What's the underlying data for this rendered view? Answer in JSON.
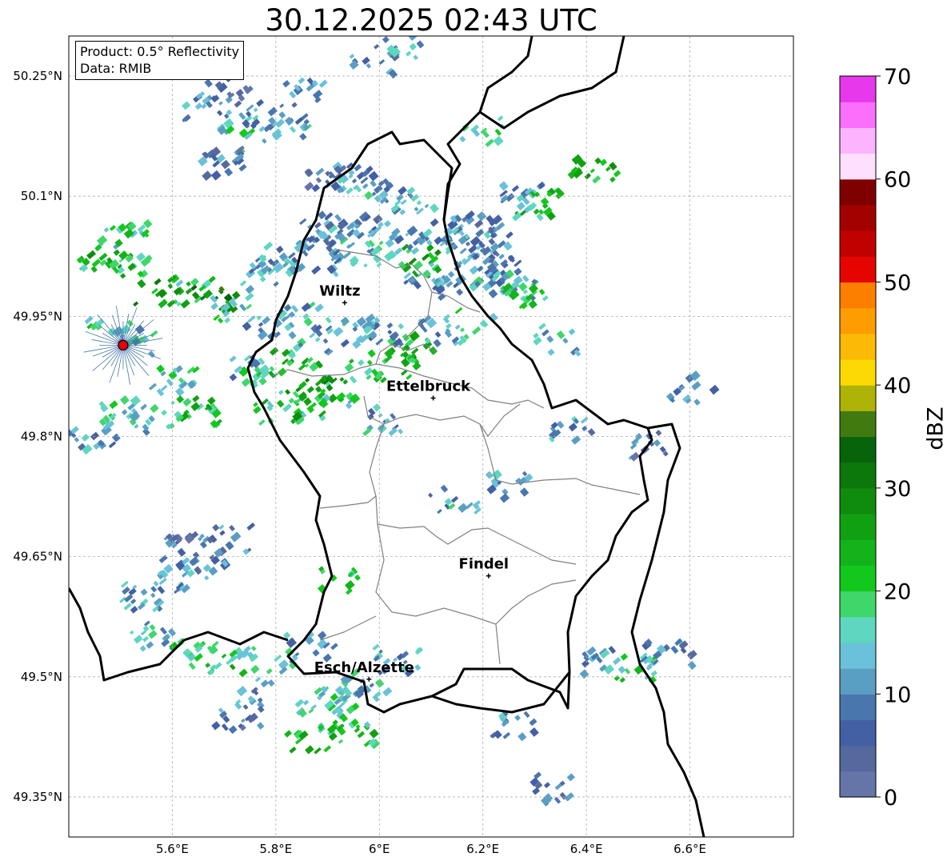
{
  "title": "30.12.2025 02:43 UTC",
  "product_box": {
    "line1": "Product: 0.5° Reflectivity",
    "line2": "Data: RMIB"
  },
  "axes": {
    "x_ticks": [
      "5.6°E",
      "5.8°E",
      "6°E",
      "6.2°E",
      "6.4°E",
      "6.6°E"
    ],
    "x_values": [
      5.6,
      5.8,
      6.0,
      6.2,
      6.4,
      6.6
    ],
    "y_ticks": [
      "50.25°N",
      "50.1°N",
      "49.95°N",
      "49.8°N",
      "49.65°N",
      "49.5°N",
      "49.35°N"
    ],
    "y_values": [
      50.25,
      50.1,
      49.95,
      49.8,
      49.65,
      49.5,
      49.35
    ],
    "lon_range": [
      5.4,
      6.8
    ],
    "lat_range": [
      49.3,
      50.3
    ],
    "grid": true
  },
  "cities": [
    {
      "name": "Wiltz",
      "lon": 5.933,
      "lat": 49.967
    },
    {
      "name": "Ettelbruck",
      "lon": 6.104,
      "lat": 49.848
    },
    {
      "name": "Findel",
      "lon": 6.211,
      "lat": 49.626
    },
    {
      "name": "Esch/Alzette",
      "lon": 5.98,
      "lat": 49.497
    }
  ],
  "radar_site": {
    "lon": 5.505,
    "lat": 49.914,
    "color": "#e8000b"
  },
  "colorbar": {
    "label": "dBZ",
    "min": 0,
    "max": 70,
    "step": 2.5,
    "tick_labels": [
      "0",
      "10",
      "20",
      "30",
      "40",
      "50",
      "60",
      "70"
    ],
    "tick_values": [
      0,
      10,
      20,
      30,
      40,
      50,
      60,
      70
    ],
    "colors": [
      "#6675a8",
      "#56699f",
      "#4460a4",
      "#4a76ae",
      "#5a9ec4",
      "#69c2d9",
      "#5fd6c0",
      "#3fd66a",
      "#13c81d",
      "#13b41b",
      "#12a013",
      "#0f8c0e",
      "#0c780c",
      "#07640a",
      "#427a12",
      "#aeb307",
      "#fdd903",
      "#fcb905",
      "#fd9d01",
      "#fd7f00",
      "#e50500",
      "#c00100",
      "#a30100",
      "#7e0100",
      "#fee0fe",
      "#fdb4fe",
      "#fc6ffc",
      "#e738ec"
    ]
  },
  "colors": {
    "border": "#000000",
    "canton": "#808080",
    "grid": "#b0b0b0"
  },
  "reflectivity_cells": [
    [
      5.66,
      50.21,
      10
    ],
    [
      5.72,
      50.2,
      12
    ],
    [
      5.78,
      50.2,
      8
    ],
    [
      5.73,
      50.17,
      16
    ],
    [
      5.7,
      50.23,
      6
    ],
    [
      5.94,
      50.12,
      10
    ],
    [
      5.9,
      50.12,
      8
    ],
    [
      5.97,
      50.11,
      12
    ],
    [
      5.95,
      50.03,
      14
    ],
    [
      5.88,
      50.05,
      10
    ],
    [
      5.92,
      50.06,
      8
    ],
    [
      5.87,
      50.02,
      12
    ],
    [
      6.18,
      50.06,
      8
    ],
    [
      6.2,
      50.04,
      10
    ],
    [
      6.16,
      50.03,
      12
    ],
    [
      6.22,
      50.01,
      8
    ],
    [
      6.14,
      49.99,
      10
    ],
    [
      6.09,
      50.0,
      12
    ],
    [
      6.25,
      49.99,
      14
    ],
    [
      6.06,
      50.02,
      24
    ],
    [
      5.63,
      49.98,
      20
    ],
    [
      5.67,
      49.97,
      30
    ],
    [
      5.72,
      49.96,
      18
    ],
    [
      5.76,
      50.0,
      14
    ],
    [
      5.79,
      50.02,
      12
    ],
    [
      5.45,
      50.02,
      22
    ],
    [
      5.5,
      50.01,
      20
    ],
    [
      5.57,
      49.98,
      26
    ],
    [
      5.47,
      49.93,
      18
    ],
    [
      5.52,
      49.92,
      14
    ],
    [
      5.6,
      49.87,
      16
    ],
    [
      5.64,
      49.83,
      22
    ],
    [
      5.56,
      49.82,
      14
    ],
    [
      5.48,
      49.83,
      16
    ],
    [
      5.44,
      49.8,
      10
    ],
    [
      5.76,
      49.87,
      18
    ],
    [
      5.8,
      49.83,
      20
    ],
    [
      5.86,
      49.84,
      22
    ],
    [
      5.91,
      49.85,
      18
    ],
    [
      5.96,
      49.88,
      20
    ],
    [
      6.02,
      49.89,
      24
    ],
    [
      6.05,
      49.91,
      22
    ],
    [
      5.94,
      49.93,
      12
    ],
    [
      5.86,
      49.92,
      14
    ],
    [
      5.73,
      49.89,
      12
    ],
    [
      5.78,
      49.93,
      10
    ],
    [
      5.83,
      49.95,
      12
    ],
    [
      6.0,
      49.93,
      10
    ],
    [
      6.12,
      49.93,
      12
    ],
    [
      6.17,
      49.94,
      16
    ],
    [
      6.3,
      50.09,
      22
    ],
    [
      6.27,
      50.1,
      12
    ],
    [
      6.41,
      50.13,
      24
    ],
    [
      6.19,
      50.18,
      18
    ],
    [
      6.06,
      50.09,
      12
    ],
    [
      6.37,
      49.81,
      10
    ],
    [
      6.52,
      49.79,
      8
    ],
    [
      6.6,
      49.86,
      10
    ],
    [
      6.24,
      49.74,
      12
    ],
    [
      6.32,
      49.36,
      8
    ],
    [
      6.48,
      49.51,
      18
    ],
    [
      6.41,
      49.52,
      12
    ],
    [
      6.55,
      49.53,
      10
    ],
    [
      5.62,
      49.66,
      8
    ],
    [
      5.7,
      49.67,
      8
    ],
    [
      5.6,
      49.62,
      10
    ],
    [
      5.54,
      49.6,
      12
    ],
    [
      5.55,
      49.55,
      14
    ],
    [
      5.63,
      49.53,
      18
    ],
    [
      5.7,
      49.52,
      20
    ],
    [
      5.78,
      49.52,
      14
    ],
    [
      5.86,
      49.54,
      12
    ],
    [
      5.88,
      49.47,
      16
    ],
    [
      5.92,
      49.45,
      18
    ],
    [
      5.94,
      49.43,
      20
    ],
    [
      5.96,
      49.49,
      14
    ],
    [
      6.03,
      49.52,
      12
    ],
    [
      5.86,
      49.42,
      22
    ],
    [
      5.76,
      49.48,
      10
    ],
    [
      5.72,
      49.45,
      8
    ],
    [
      5.92,
      49.62,
      20
    ],
    [
      5.65,
      49.64,
      10
    ],
    [
      6.14,
      49.72,
      12
    ],
    [
      6.25,
      49.44,
      10
    ],
    [
      5.5,
      50.05,
      18
    ],
    [
      5.98,
      50.06,
      8
    ],
    [
      6.02,
      50.04,
      12
    ],
    [
      6.11,
      50.05,
      10
    ],
    [
      6.27,
      49.97,
      20
    ],
    [
      6.33,
      49.92,
      14
    ],
    [
      5.69,
      50.14,
      8
    ],
    [
      5.81,
      50.19,
      12
    ],
    [
      5.85,
      50.23,
      10
    ],
    [
      5.98,
      50.27,
      8
    ],
    [
      6.05,
      50.29,
      12
    ],
    [
      6.17,
      50.06,
      10
    ],
    [
      6.19,
      50.0,
      12
    ],
    [
      5.83,
      49.89,
      22
    ],
    [
      5.88,
      49.86,
      26
    ],
    [
      5.99,
      49.82,
      12
    ]
  ],
  "overlay_note": ""
}
